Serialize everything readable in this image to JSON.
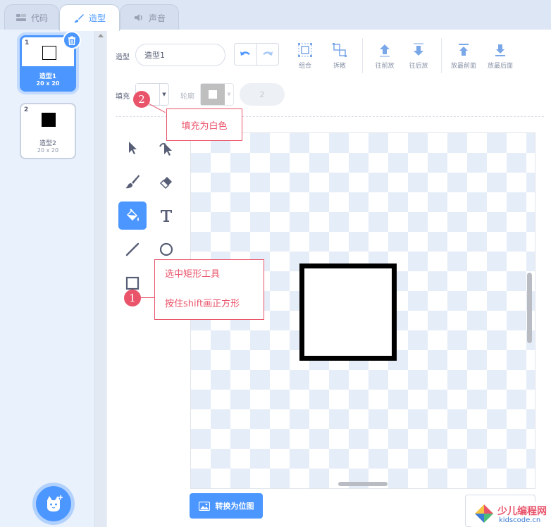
{
  "tabs": [
    {
      "label": "代码",
      "icon": "code-icon"
    },
    {
      "label": "造型",
      "icon": "brush-icon",
      "active": true
    },
    {
      "label": "声音",
      "icon": "speaker-icon"
    }
  ],
  "costumes": [
    {
      "number": "1",
      "name": "造型1",
      "size": "20 x 20",
      "selected": true,
      "thumb": "white-square"
    },
    {
      "number": "2",
      "name": "造型2",
      "size": "20 x 20",
      "selected": false,
      "thumb": "black-square"
    }
  ],
  "toolbar": {
    "costume_label": "造型",
    "costume_name": "造型1",
    "group_label": "组合",
    "ungroup_label": "拆散",
    "forward_label": "往前放",
    "backward_label": "往后放",
    "front_label": "放最前面",
    "back_label": "放最后面",
    "fill_label": "填充",
    "outline_label": "轮廓",
    "stroke_width": "2"
  },
  "colors": {
    "accent": "#4c97ff",
    "annotation": "#e9546b"
  },
  "tools": [
    "select-icon",
    "reshape-icon",
    "brush-icon",
    "eraser-icon",
    "fill-icon",
    "text-icon",
    "line-icon",
    "circle-icon",
    "rectangle-icon"
  ],
  "active_tool": "fill-icon",
  "convert_button": "转换为位图",
  "annotations": {
    "note1_line1": "选中矩形工具",
    "note1_line2": "按住shift画正方形",
    "marker1": "1",
    "note2": "填充为白色",
    "marker2": "2"
  },
  "watermark": {
    "title": "少儿编程网",
    "url": "kidscode.cn"
  }
}
